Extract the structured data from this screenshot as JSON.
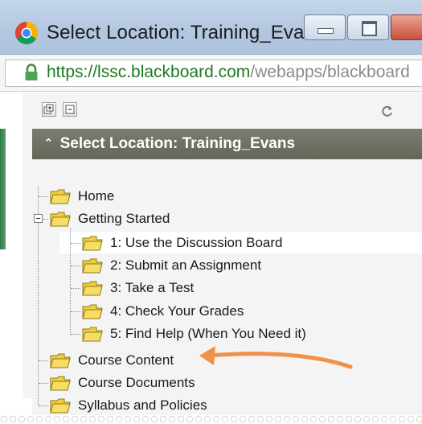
{
  "window": {
    "title": "Select Location: Training_Eva...",
    "colors": {
      "titlebar": "#b8cbe4",
      "close": "#c8503a"
    }
  },
  "address_bar": {
    "host": "https://lssc.blackboard.com",
    "path": "/webapps/blackboard",
    "host_color": "#1e7a22"
  },
  "toolbar": {
    "expand_icon": "expand-all-icon",
    "collapse_icon": "collapse-all-icon",
    "refresh_icon": "refresh-icon"
  },
  "panel": {
    "header": "Select Location: Training_Evans",
    "header_color": "#6f6e62"
  },
  "tree": {
    "items": [
      {
        "label": "Home",
        "level": 0
      },
      {
        "label": "Getting Started",
        "level": 0,
        "expanded": true
      },
      {
        "label": "1: Use the Discussion Board",
        "level": 1,
        "highlighted": true
      },
      {
        "label": "2: Submit an Assignment",
        "level": 1
      },
      {
        "label": "3: Take a Test",
        "level": 1
      },
      {
        "label": "4: Check Your Grades",
        "level": 1
      },
      {
        "label": "5: Find Help (When You Need it)",
        "level": 1
      },
      {
        "label": "Course Content",
        "level": 0
      },
      {
        "label": "Course Documents",
        "level": 0
      },
      {
        "label": "Syllabus and Policies",
        "level": 0
      }
    ],
    "folder_color": "#f2cf3a",
    "annotation_arrow_color": "#f0914a"
  }
}
